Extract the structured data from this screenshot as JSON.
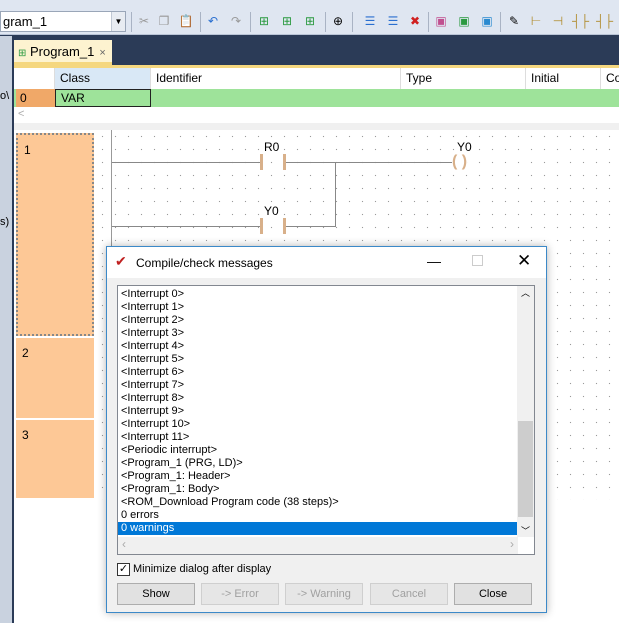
{
  "toolbar": {
    "program_combo": "gram_1",
    "icons": [
      "cut-icon",
      "copy-icon",
      "paste-icon",
      "undo-icon",
      "redo-icon",
      "compile-icon",
      "compile-all-icon",
      "check-icon",
      "transfer-icon",
      "insert-network-icon",
      "append-network-icon",
      "delete-network-icon",
      "edit-icon",
      "program-icon",
      "component-icon",
      "pencil-icon",
      "wire-icon",
      "wire-icon",
      "contact-icon",
      "contact-icon"
    ]
  },
  "tab": {
    "label": "Program_1",
    "close": "×"
  },
  "header": {
    "columns": [
      "Class",
      "Identifier",
      "Type",
      "Initial",
      "Co"
    ]
  },
  "declaration": {
    "row_number": "0",
    "class": "VAR"
  },
  "scroll_left": "<",
  "ladder": {
    "rows": [
      "1",
      "2",
      "3"
    ],
    "contact1": "R0",
    "contact2": "Y0",
    "coil": "Y0",
    "side_text1": "o\\",
    "side_text2": "s)"
  },
  "dialog": {
    "title": "Compile/check messages",
    "messages": [
      "<Interrupt 0>",
      "<Interrupt 1>",
      "<Interrupt 2>",
      "<Interrupt 3>",
      "<Interrupt 4>",
      "<Interrupt 5>",
      "<Interrupt 6>",
      "<Interrupt 7>",
      "<Interrupt 8>",
      "<Interrupt 9>",
      "<Interrupt 10>",
      "<Interrupt 11>",
      "<Periodic interrupt>",
      "<Program_1 (PRG, LD)>",
      "<Program_1: Header>",
      "<Program_1: Body>",
      "<ROM_Download Program code (38 steps)>",
      "0 errors",
      "0 warnings"
    ],
    "selected_index": 18,
    "checkbox_label": "Minimize dialog after display",
    "checkbox_checked": true,
    "buttons": {
      "show": "Show",
      "error": "-> Error",
      "warning": "-> Warning",
      "cancel": "Cancel",
      "close": "Close"
    }
  },
  "colors": {
    "row_number_bg": "#fdc896",
    "var_row_bg": "#9ee39a",
    "selection": "#0078d7",
    "wire": "#d8b08a"
  }
}
